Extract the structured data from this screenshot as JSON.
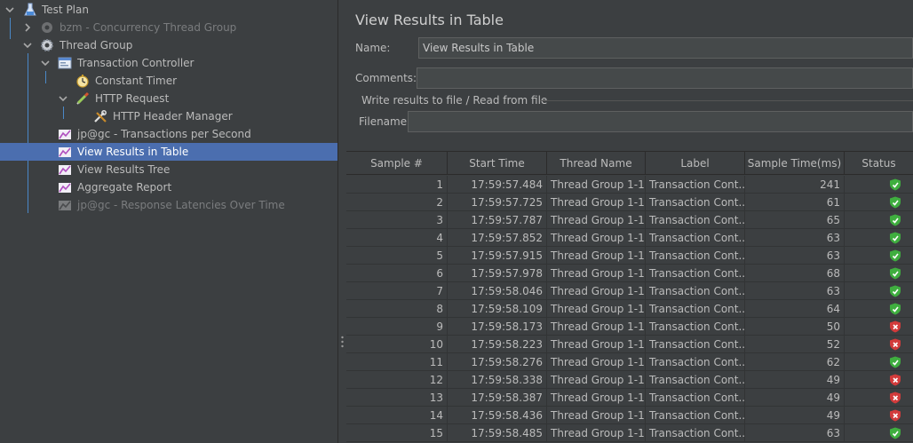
{
  "tree": {
    "items": [
      {
        "label": "Test Plan",
        "icon": "flask-icon",
        "state": "normal"
      },
      {
        "label": "bzm - Concurrency Thread Group",
        "icon": "gear-icon",
        "state": "disabled"
      },
      {
        "label": "Thread Group",
        "icon": "gear-icon",
        "state": "normal"
      },
      {
        "label": "Transaction Controller",
        "icon": "controller-icon",
        "state": "normal"
      },
      {
        "label": "Constant Timer",
        "icon": "stopwatch-icon",
        "state": "normal"
      },
      {
        "label": "HTTP Request",
        "icon": "pipette-icon",
        "state": "normal"
      },
      {
        "label": "HTTP Header Manager",
        "icon": "wrench-icon",
        "state": "normal"
      },
      {
        "label": "jp@gc - Transactions per Second",
        "icon": "graph-icon",
        "state": "normal"
      },
      {
        "label": "View Results in Table",
        "icon": "graph-icon",
        "state": "selected"
      },
      {
        "label": "View Results Tree",
        "icon": "graph-icon",
        "state": "normal"
      },
      {
        "label": "Aggregate Report",
        "icon": "graph-icon",
        "state": "normal"
      },
      {
        "label": "jp@gc - Response Latencies Over Time",
        "icon": "graph-icon",
        "state": "disabled"
      }
    ]
  },
  "panel": {
    "title": "View Results in Table",
    "name_label": "Name:",
    "name_value": "View Results in Table",
    "comments_label": "Comments:",
    "comments_value": "",
    "file_group_title": "Write results to file / Read from file",
    "filename_label": "Filename",
    "filename_value": ""
  },
  "table": {
    "columns": [
      "Sample #",
      "Start Time",
      "Thread Name",
      "Label",
      "Sample Time(ms)",
      "Status"
    ],
    "rows": [
      {
        "sample": "1",
        "start": "17:59:57.484",
        "thread": "Thread Group 1-1",
        "label": "Transaction Cont...",
        "time": "241",
        "status": "success"
      },
      {
        "sample": "2",
        "start": "17:59:57.725",
        "thread": "Thread Group 1-1",
        "label": "Transaction Cont...",
        "time": "61",
        "status": "success"
      },
      {
        "sample": "3",
        "start": "17:59:57.787",
        "thread": "Thread Group 1-1",
        "label": "Transaction Cont...",
        "time": "65",
        "status": "success"
      },
      {
        "sample": "4",
        "start": "17:59:57.852",
        "thread": "Thread Group 1-1",
        "label": "Transaction Cont...",
        "time": "63",
        "status": "success"
      },
      {
        "sample": "5",
        "start": "17:59:57.915",
        "thread": "Thread Group 1-1",
        "label": "Transaction Cont...",
        "time": "63",
        "status": "success"
      },
      {
        "sample": "6",
        "start": "17:59:57.978",
        "thread": "Thread Group 1-1",
        "label": "Transaction Cont...",
        "time": "68",
        "status": "success"
      },
      {
        "sample": "7",
        "start": "17:59:58.046",
        "thread": "Thread Group 1-1",
        "label": "Transaction Cont...",
        "time": "63",
        "status": "success"
      },
      {
        "sample": "8",
        "start": "17:59:58.109",
        "thread": "Thread Group 1-1",
        "label": "Transaction Cont...",
        "time": "64",
        "status": "success"
      },
      {
        "sample": "9",
        "start": "17:59:58.173",
        "thread": "Thread Group 1-1",
        "label": "Transaction Cont...",
        "time": "50",
        "status": "failure"
      },
      {
        "sample": "10",
        "start": "17:59:58.223",
        "thread": "Thread Group 1-1",
        "label": "Transaction Cont...",
        "time": "52",
        "status": "failure"
      },
      {
        "sample": "11",
        "start": "17:59:58.276",
        "thread": "Thread Group 1-1",
        "label": "Transaction Cont...",
        "time": "62",
        "status": "success"
      },
      {
        "sample": "12",
        "start": "17:59:58.338",
        "thread": "Thread Group 1-1",
        "label": "Transaction Cont...",
        "time": "49",
        "status": "failure"
      },
      {
        "sample": "13",
        "start": "17:59:58.387",
        "thread": "Thread Group 1-1",
        "label": "Transaction Cont...",
        "time": "49",
        "status": "failure"
      },
      {
        "sample": "14",
        "start": "17:59:58.436",
        "thread": "Thread Group 1-1",
        "label": "Transaction Cont...",
        "time": "49",
        "status": "failure"
      },
      {
        "sample": "15",
        "start": "17:59:58.485",
        "thread": "Thread Group 1-1",
        "label": "Transaction Cont...",
        "time": "63",
        "status": "success"
      }
    ]
  },
  "colors": {
    "selection": "#4b6eaf",
    "success": "#3fae3f",
    "failure": "#d23b3b",
    "tree_line": "#4a88c7"
  }
}
